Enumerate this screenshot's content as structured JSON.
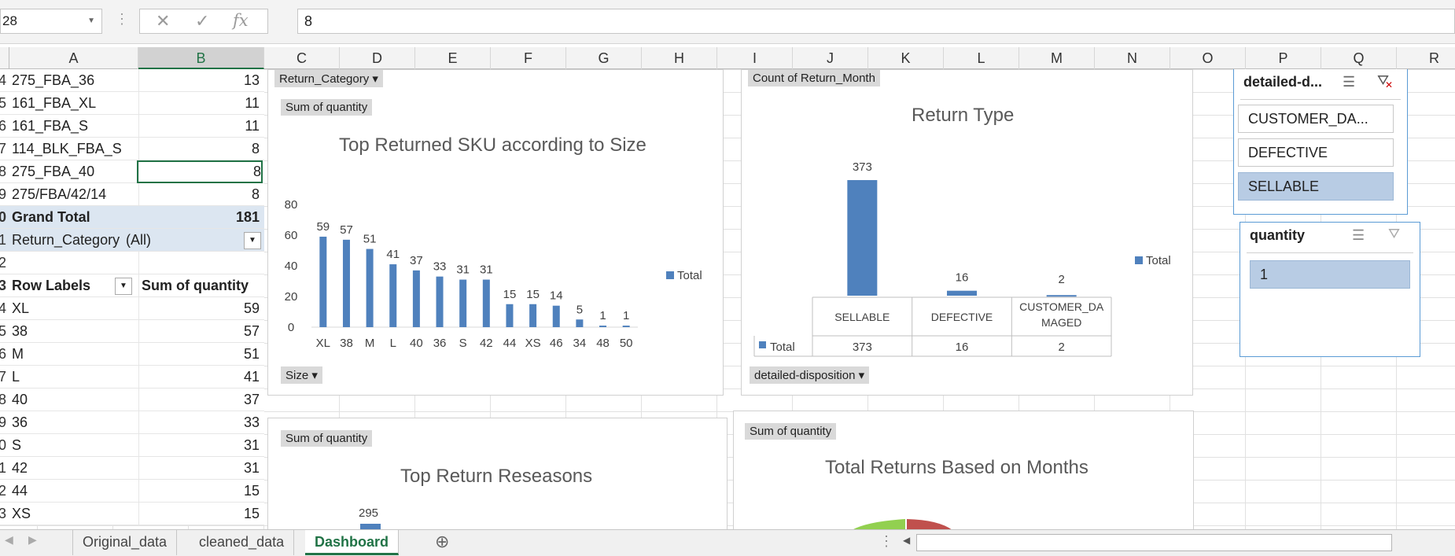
{
  "formula_bar": {
    "name_box": "28",
    "cancel": "✕",
    "enter": "✓",
    "fx": "fx",
    "value": "8"
  },
  "columns": [
    "A",
    "B",
    "C",
    "D",
    "E",
    "F",
    "G",
    "H",
    "I",
    "J",
    "K",
    "L",
    "M",
    "N",
    "O",
    "P",
    "Q",
    "R"
  ],
  "selected_column": "B",
  "pivot_rows": [
    {
      "rn": "4",
      "a": "275_FBA_36",
      "b": "13"
    },
    {
      "rn": "5",
      "a": "161_FBA_XL",
      "b": "11"
    },
    {
      "rn": "6",
      "a": "161_FBA_S",
      "b": "11"
    },
    {
      "rn": "7",
      "a": "114_BLK_FBA_S",
      "b": "8"
    },
    {
      "rn": "8",
      "a": "275_FBA_40",
      "b": "8"
    },
    {
      "rn": "9",
      "a": "275/FBA/42/14",
      "b": "8"
    },
    {
      "rn": "0",
      "a": "Grand Total",
      "b": "181"
    },
    {
      "rn": "1",
      "a": "Return_Category",
      "b": "(All)"
    },
    {
      "rn": "2",
      "a": "",
      "b": ""
    },
    {
      "rn": "3",
      "a": "Row Labels",
      "b": "Sum of quantity"
    },
    {
      "rn": "4",
      "a": "XL",
      "b": "59"
    },
    {
      "rn": "5",
      "a": "38",
      "b": "57"
    },
    {
      "rn": "6",
      "a": "M",
      "b": "51"
    },
    {
      "rn": "7",
      "a": "L",
      "b": "41"
    },
    {
      "rn": "8",
      "a": "40",
      "b": "37"
    },
    {
      "rn": "9",
      "a": "36",
      "b": "33"
    },
    {
      "rn": "0",
      "a": "S",
      "b": "31"
    },
    {
      "rn": "1",
      "a": "42",
      "b": "31"
    },
    {
      "rn": "2",
      "a": "44",
      "b": "15"
    },
    {
      "rn": "3",
      "a": "XS",
      "b": "15"
    }
  ],
  "chart1": {
    "filter_top": "Return_Category ▾",
    "value_btn": "Sum of quantity",
    "axis_btn": "Size ▾",
    "legend": "Total"
  },
  "chart2": {
    "value_btn": "Count of Return_Month",
    "axis_btn": "detailed-disposition ▾",
    "legend": "Total",
    "table_row_label": "Total"
  },
  "chart3": {
    "value_btn": "Sum of quantity",
    "title": "Top Return Reseasons",
    "top_label": "295"
  },
  "chart4": {
    "value_btn": "Sum of quantity",
    "title": "Total Returns Based on Months"
  },
  "chart_data": [
    {
      "type": "bar",
      "title": "Top Returned SKU according to Size",
      "categories": [
        "XL",
        "38",
        "M",
        "L",
        "40",
        "36",
        "S",
        "42",
        "44",
        "XS",
        "46",
        "34",
        "48",
        "50"
      ],
      "series": [
        {
          "name": "Total",
          "values": [
            59,
            57,
            51,
            41,
            37,
            33,
            31,
            31,
            15,
            15,
            14,
            5,
            1,
            1
          ]
        }
      ],
      "ylim": [
        0,
        80
      ],
      "yticks": [
        0,
        20,
        40,
        60,
        80
      ],
      "legend": "right"
    },
    {
      "type": "bar",
      "title": "Return Type",
      "categories": [
        "SELLABLE",
        "DEFECTIVE",
        "CUSTOMER_DAMAGED"
      ],
      "category_labels": [
        "SELLABLE",
        "DEFECTIVE",
        "CUSTOMER_DA\nMAGED"
      ],
      "series": [
        {
          "name": "Total",
          "values": [
            373,
            16,
            2
          ]
        }
      ],
      "legend": "right",
      "data_table": true
    }
  ],
  "slicers": [
    {
      "header": "detailed-d...",
      "items": [
        {
          "label": "CUSTOMER_DA...",
          "selected": false
        },
        {
          "label": "DEFECTIVE",
          "selected": false
        },
        {
          "label": "SELLABLE",
          "selected": true
        }
      ]
    },
    {
      "header": "quantity",
      "items": [
        {
          "label": "1",
          "selected": true
        }
      ]
    }
  ],
  "tabs": [
    "Original_data",
    "cleaned_data",
    "Dashboard"
  ],
  "active_tab": "Dashboard",
  "colors": {
    "bar": "#4f81bd",
    "accent": "#217346",
    "slicer_sel": "#b8cce4"
  }
}
